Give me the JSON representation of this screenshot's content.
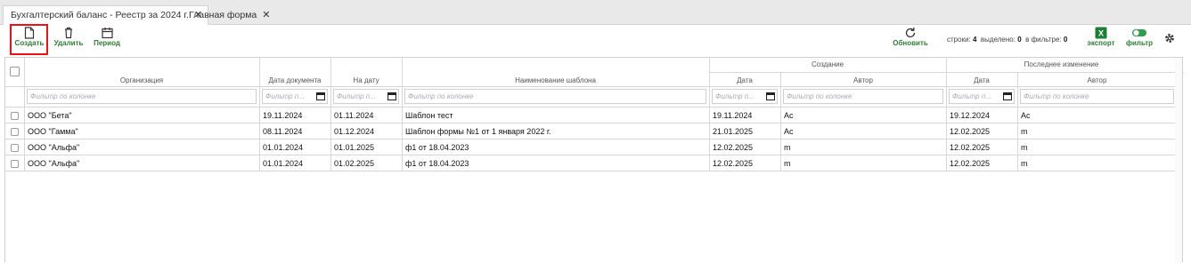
{
  "tabs": [
    {
      "label": "Бухгалтерский баланс - Реестр за 2024 г."
    },
    {
      "label": "Главная форма"
    }
  ],
  "toolbar": {
    "create": "Создать",
    "delete": "Удалить",
    "period": "Период",
    "refresh": "Обновить",
    "export": "экспорт",
    "filter": "фильтр"
  },
  "stats": {
    "rows_label": "строки:",
    "rows": "4",
    "selected_label": "выделено:",
    "selected": "0",
    "in_filter_label": "в фильтре:",
    "in_filter": "0"
  },
  "columns": {
    "org": "Организация",
    "doc_date": "Дата документа",
    "on_date": "На дату",
    "template": "Наименование шаблона",
    "created_group": "Создание",
    "created_date": "Дата",
    "created_author": "Автор",
    "changed_group": "Последнее изменение",
    "changed_date": "Дата",
    "changed_author": "Автор"
  },
  "filters": {
    "wide": "Фильтр по колонке",
    "narrow": "Фильтр п..."
  },
  "rows": [
    [
      "ООО \"Бета\"",
      "19.11.2024",
      "01.11.2024",
      "Шаблон тест",
      "19.11.2024",
      "Ас",
      "19.12.2024",
      "Ас"
    ],
    [
      "ООО \"Гамма\"",
      "08.11.2024",
      "01.12.2024",
      "Шаблон формы №1 от 1 января 2022 г.",
      "21.01.2025",
      "Ас",
      "12.02.2025",
      "m"
    ],
    [
      "ООО \"Альфа\"",
      "01.01.2024",
      "01.01.2025",
      "ф1 от 18.04.2023",
      "12.02.2025",
      "m",
      "12.02.2025",
      "m"
    ],
    [
      "ООО \"Альфа\"",
      "01.01.2024",
      "01.02.2025",
      "ф1 от 18.04.2023",
      "12.02.2025",
      "m",
      "12.02.2025",
      "m"
    ]
  ]
}
